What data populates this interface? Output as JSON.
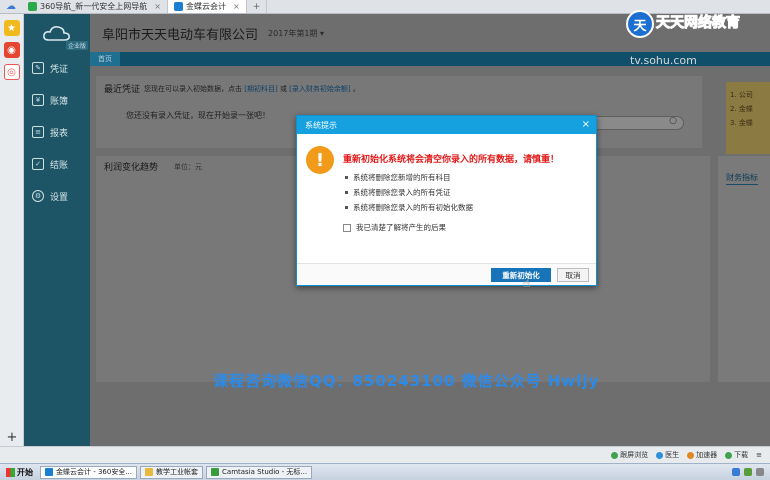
{
  "browser": {
    "tabs": [
      {
        "label": "360导航_新一代安全上网导航",
        "active": false
      },
      {
        "label": "金蝶云会计",
        "active": true
      }
    ],
    "new_tab": "+"
  },
  "app": {
    "logo_badge": "企业版",
    "company_name": "阜阳市天天电动车有限公司",
    "period": "2017年第1期",
    "nav": [
      {
        "label": "凭证",
        "icon": "voucher-icon"
      },
      {
        "label": "账簿",
        "icon": "ledger-icon"
      },
      {
        "label": "报表",
        "icon": "report-icon"
      },
      {
        "label": "结账",
        "icon": "close-period-icon"
      },
      {
        "label": "设置",
        "icon": "settings-gear-icon"
      }
    ],
    "subtab_home": "首页",
    "recent_vouchers": {
      "title": "最近凭证",
      "hint_prefix": "您现在可以录入初始数据，点击",
      "hint_link1": "[期初科目]",
      "hint_or": "或",
      "hint_link2": "[录入财务初始余额]",
      "hint_suffix": "。",
      "empty_msg": "您还没有录入凭证，现在开始录一张吧！",
      "search_text": "搜"
    },
    "profit_trend": {
      "title": "利润变化趋势",
      "unit": "单位：元"
    },
    "finance_indicators": "财务指标",
    "note_lines": [
      "1. 公司",
      "2. 金蝶",
      "3. 金蝶"
    ]
  },
  "dialog": {
    "title": "系统提示",
    "heading": "重新初始化系统将会清空你录入的所有数据，请慎重！",
    "items": [
      "系统将删除您新增的所有科目",
      "系统将删除您录入的所有凭证",
      "系统将删除您录入的所有初始化数据"
    ],
    "confirm_label": "我已清楚了解将产生的后果",
    "primary_button": "重新初始化",
    "cancel_button": "取消"
  },
  "watermark": {
    "line": "课程咨询微信QQ：850243100   微信公众号 Hwljy",
    "brand": "天天网络教育",
    "sohu_text": "tv.sohu.com"
  },
  "statusbar": {
    "items": [
      "跟屏浏览",
      "医生",
      "加速器",
      "下载"
    ]
  },
  "taskbar": {
    "start": "开始",
    "tasks": [
      {
        "label": "金蝶云会计 - 360安全...",
        "active": true
      },
      {
        "label": "教学工业帐套",
        "active": false
      },
      {
        "label": "Camtasia Studio - 无标...",
        "active": false
      }
    ]
  },
  "colors": {
    "sidebar": "#1d5566",
    "dialog_title": "#15a0e0",
    "primary_button": "#1874b8",
    "warning": "#f29a1a",
    "danger_text": "#e41b1b"
  }
}
